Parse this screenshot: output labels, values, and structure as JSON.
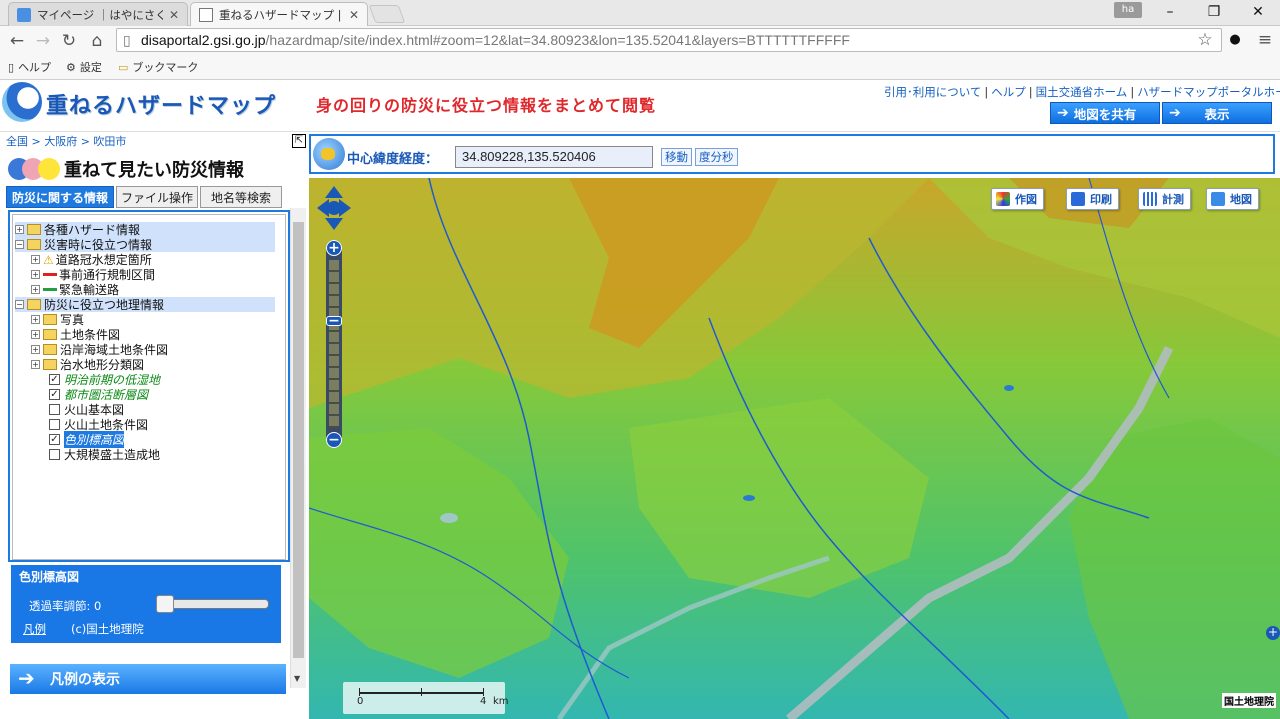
{
  "browser": {
    "tabs": [
      {
        "title": "マイページ ｜はやにさく｜ みんな"
      },
      {
        "title": "重ねるハザードマップ | 国土交"
      }
    ],
    "profile": "ha",
    "window_controls": {
      "minimize": "–",
      "maximize": "❐",
      "close": "✕"
    },
    "url_host": "disaportal2.gsi.go.jp",
    "url_path": "/hazardmap/site/index.html#zoom=12&lat=34.80923&lon=135.52041&layers=BTTTTTTFFFFF",
    "bookmarks": [
      {
        "label": "ヘルプ"
      },
      {
        "label": "設定"
      },
      {
        "label": "ブックマーク"
      }
    ]
  },
  "header": {
    "title": "重ねるハザードマップ",
    "tagline": "身の回りの防災に役立つ情報をまとめて閲覧",
    "links": [
      "引用･利用について",
      "ヘルプ",
      "国土交通省ホーム",
      "ハザードマップポータルホーム"
    ],
    "share_button": "地図を共有",
    "show_button": "表示"
  },
  "left": {
    "breadcrumb": "全国 > 大阪府 > 吹田市",
    "title": "ねて見たい防災情報",
    "title_first": "重",
    "tabs": [
      "防災に関する情報",
      "ファイル操作",
      "地名等検索"
    ],
    "tree": [
      {
        "label": "各種ハザード情報",
        "expand": "+",
        "hl": true
      },
      {
        "label": "災害時に役立つ情報",
        "expand": "−",
        "hl": true
      },
      {
        "label": "道路冠水想定箇所",
        "expand": "+"
      },
      {
        "label": "事前通行規制区間",
        "expand": "+"
      },
      {
        "label": "緊急輸送路",
        "expand": "+"
      },
      {
        "label": "防災に役立つ地理情報",
        "expand": "−",
        "hl": true
      },
      {
        "label": "写真",
        "expand": "+"
      },
      {
        "label": "土地条件図",
        "expand": "+"
      },
      {
        "label": "沿岸海域土地条件図",
        "expand": "+"
      },
      {
        "label": "治水地形分類図",
        "expand": "+"
      },
      {
        "label": "明治前期の低湿地",
        "checked": "✓"
      },
      {
        "label": "都市圏活断層図",
        "checked": "✓"
      },
      {
        "label": "火山基本図",
        "checked": ""
      },
      {
        "label": "火山土地条件図",
        "checked": ""
      },
      {
        "label": "色別標高図",
        "checked": "✓"
      },
      {
        "label": "大規模盛土造成地",
        "checked": ""
      }
    ],
    "legend": {
      "title": "色別標高図",
      "opacity_label": "透過率調節: 0",
      "opacity_value": 0,
      "legend_link": "凡例",
      "copyright": "(c)国土地理院"
    },
    "show_legend_button": "凡例の表示"
  },
  "coords": {
    "label": "中心緯度経度：",
    "value": "34.809228,135.520406",
    "move_button": "移動",
    "dms_button": "度分秒"
  },
  "map": {
    "buttons": [
      "作図",
      "印刷",
      "計測",
      "地図"
    ],
    "scale_start": "0",
    "scale_end": "4",
    "scale_unit": "km",
    "credit": "国土地理院",
    "colors": {
      "water": "#3cbcb4",
      "low": "#7ccf3a",
      "mid": "#d6b422",
      "high": "#b07820",
      "river": "#1f5bd0"
    }
  }
}
